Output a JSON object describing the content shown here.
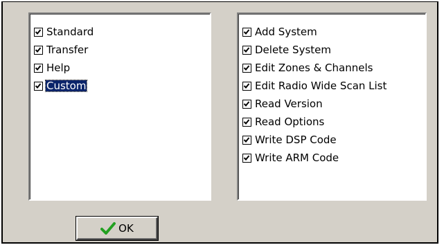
{
  "left_list": {
    "items": [
      {
        "label": "Standard",
        "checked": true,
        "selected": false
      },
      {
        "label": "Transfer",
        "checked": true,
        "selected": false
      },
      {
        "label": "Help",
        "checked": true,
        "selected": false
      },
      {
        "label": "Custom",
        "checked": true,
        "selected": true
      }
    ]
  },
  "right_list": {
    "items": [
      {
        "label": "Add System",
        "checked": true
      },
      {
        "label": "Delete System",
        "checked": true
      },
      {
        "label": "Edit Zones & Channels",
        "checked": true
      },
      {
        "label": "Edit Radio Wide Scan List",
        "checked": true
      },
      {
        "label": "Read Version",
        "checked": true
      },
      {
        "label": "Read Options",
        "checked": true
      },
      {
        "label": "Write DSP Code",
        "checked": true
      },
      {
        "label": "Write ARM Code",
        "checked": true
      }
    ]
  },
  "ok_button": {
    "label": "OK",
    "icon": "check-icon",
    "icon_color": "#22a020"
  },
  "colors": {
    "dialog_background": "#d4d0c8",
    "selection_background": "#0a246a"
  }
}
